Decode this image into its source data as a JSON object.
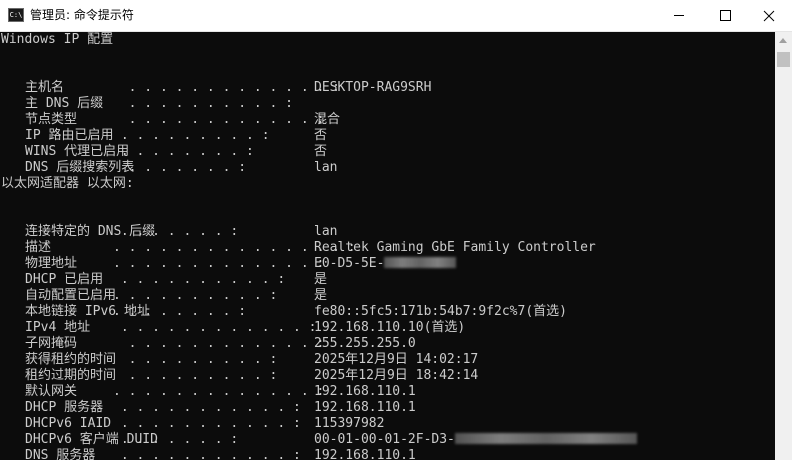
{
  "window": {
    "title": "管理员: 命令提示符",
    "icon_text": "C:\\",
    "icons": {
      "app": "cmd-icon",
      "minimize": "minimize-icon",
      "maximize": "maximize-icon",
      "close": "close-icon"
    }
  },
  "console": {
    "header": "Windows IP 配置",
    "global": [
      {
        "label": "主机名",
        "dots": "  . . . . . . . . . . . . . :",
        "value": "DESKTOP-RAG9SRH"
      },
      {
        "label": "主 DNS 后缀",
        "dots": "  . . . . . . . . . . :",
        "value": ""
      },
      {
        "label": "节点类型",
        "dots": "  . . . . . . . . . . . . :",
        "value": "混合"
      },
      {
        "label": "IP 路由已启用",
        "dots": " . . . . . . . . . :",
        "value": "否"
      },
      {
        "label": "WINS 代理已启用",
        "dots": " . . . . . . . . :",
        "value": "否"
      },
      {
        "label": "DNS 后缀搜索列表",
        "dots": "  . . . . . . . :",
        "value": "lan"
      }
    ],
    "adapter_header": "以太网适配器 以太网:",
    "adapter": [
      {
        "label": "连接特定的 DNS 后缀",
        "dots": " . . . . . . . :",
        "value": "lan"
      },
      {
        "label": "描述",
        "dots": ". . . . . . . . . . . . . . . :",
        "value": "Realtek Gaming GbE Family Controller"
      },
      {
        "label": "物理地址",
        "dots": ". . . . . . . . . . . . . :",
        "value": "E0-D5-5E-"
      },
      {
        "label": "DHCP 已启用",
        "dots": " . . . . . . . . . . :",
        "value": "是"
      },
      {
        "label": "自动配置已启用",
        "dots": ". . . . . . . . . . :",
        "value": "是"
      },
      {
        "label": "本地链接 IPv6 地址",
        "dots": ". . . . . . . . :",
        "value": "fe80::5fc5:171b:54b7:9f2c%7(首选)"
      },
      {
        "label": "IPv4 地址",
        "dots": " . . . . . . . . . . . . :",
        "value": "192.168.110.10(首选)"
      },
      {
        "label": "子网掩码",
        "dots": "  . . . . . . . . . . . . :",
        "value": "255.255.255.0"
      },
      {
        "label": "获得租约的时间",
        "dots": "  . . . . . . . . . :",
        "value": "2025年12月9日 14:02:17"
      },
      {
        "label": "租约过期的时间",
        "dots": "  . . . . . . . . . :",
        "value": "2025年12月9日 18:42:14"
      },
      {
        "label": "默认网关",
        "dots": ". . . . . . . . . . . . . :",
        "value": "192.168.110.1"
      },
      {
        "label": "DHCP 服务器",
        "dots": " . . . . . . . . . . . :",
        "value": "192.168.110.1"
      },
      {
        "label": "DHCPv6 IAID",
        "dots": " . . . . . . . . . . . :",
        "value": "115397982"
      },
      {
        "label": "DHCPv6 客户端 DUID",
        "dots": " . . . . . . . :",
        "value": "00-01-00-01-2F-D3-"
      },
      {
        "label": "DNS 服务器",
        "dots": " . . . . . . . . . . . :",
        "value": "192.168.110.1"
      }
    ]
  },
  "colors": {
    "console_bg": "#0c0c0c",
    "console_text": "#cccccc",
    "titlebar_bg": "#ffffff"
  }
}
